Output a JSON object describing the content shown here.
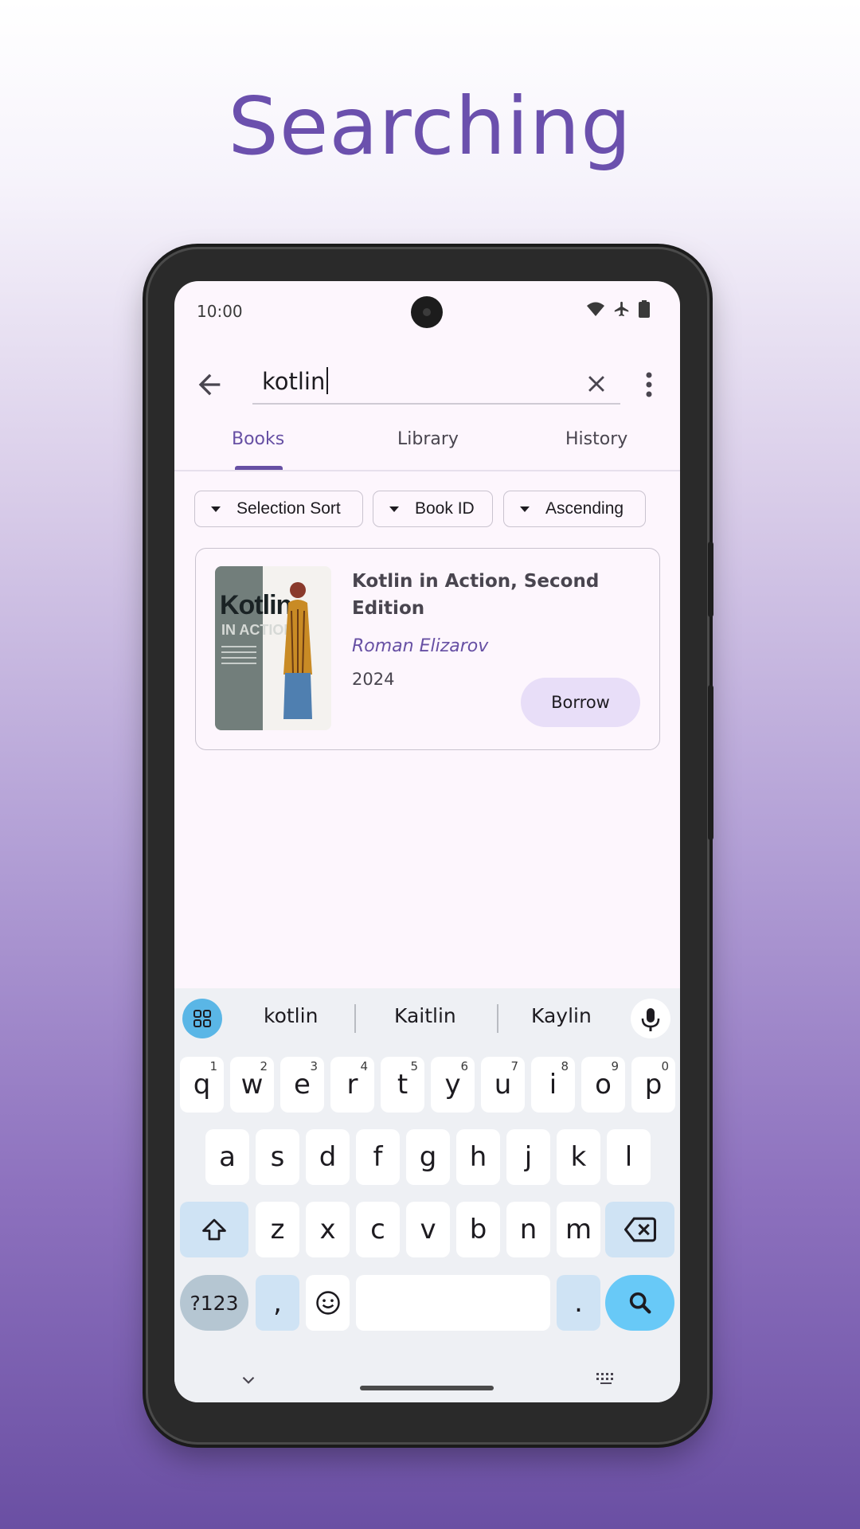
{
  "headline": "Searching",
  "status_bar": {
    "time": "10:00",
    "icons": [
      "wifi-icon",
      "airplane-icon",
      "battery-icon"
    ]
  },
  "search": {
    "query": "kotlin",
    "back_icon": "arrow-back-icon",
    "clear_icon": "close-icon",
    "more_icon": "more-vert-icon"
  },
  "tabs": [
    {
      "label": "Books",
      "active": true
    },
    {
      "label": "Library",
      "active": false
    },
    {
      "label": "History",
      "active": false
    }
  ],
  "filters": [
    {
      "label": "Selection Sort"
    },
    {
      "label": "Book ID"
    },
    {
      "label": "Ascending"
    }
  ],
  "book": {
    "title": "Kotlin in Action, Second Edition",
    "author": "Roman Elizarov",
    "year": "2024",
    "action_label": "Borrow",
    "cover_text": {
      "line1": "Kotlin",
      "line2": "IN ACTION"
    }
  },
  "keyboard": {
    "suggestions": [
      "kotlin",
      "Kaitlin",
      "Kaylin"
    ],
    "row1": [
      {
        "k": "q",
        "h": "1"
      },
      {
        "k": "w",
        "h": "2"
      },
      {
        "k": "e",
        "h": "3"
      },
      {
        "k": "r",
        "h": "4"
      },
      {
        "k": "t",
        "h": "5"
      },
      {
        "k": "y",
        "h": "6"
      },
      {
        "k": "u",
        "h": "7"
      },
      {
        "k": "i",
        "h": "8"
      },
      {
        "k": "o",
        "h": "9"
      },
      {
        "k": "p",
        "h": "0"
      }
    ],
    "row2": [
      "a",
      "s",
      "d",
      "f",
      "g",
      "h",
      "j",
      "k",
      "l"
    ],
    "row3": [
      "z",
      "x",
      "c",
      "v",
      "b",
      "n",
      "m"
    ],
    "symbols_label": "?123",
    "comma": ",",
    "period": ".",
    "colors": {
      "accent": "#68c9f7",
      "function_key": "#cfe3f4"
    }
  },
  "colors": {
    "primary": "#6750a4",
    "surface": "#fdf6fd",
    "tonal": "#e8def8"
  }
}
